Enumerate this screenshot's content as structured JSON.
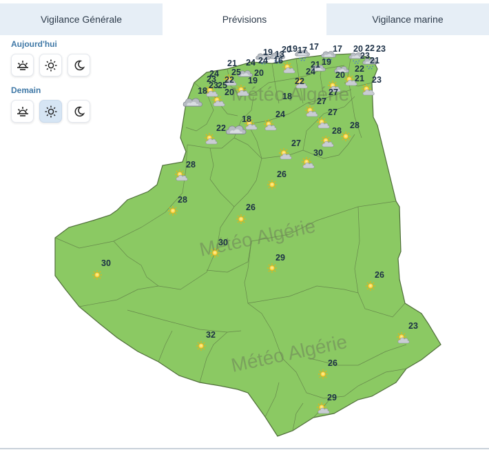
{
  "tabs": [
    {
      "label": "Vigilance Générale",
      "active": false
    },
    {
      "label": "Prévisions",
      "active": true
    },
    {
      "label": "Vigilance marine",
      "active": false
    }
  ],
  "periods": {
    "today_label": "Aujourd'hui",
    "tomorrow_label": "Demain",
    "buttons": [
      "sunrise-icon",
      "sun-icon",
      "moon-icon"
    ],
    "selected": {
      "group": "Demain",
      "button": "sun-icon"
    }
  },
  "watermark": "Météo Algérie",
  "colors": {
    "land": "#8bc963",
    "border": "#5c7a44",
    "tab_inactive": "#e6eef6",
    "label_accent": "#3f78a6"
  },
  "legend_note": "",
  "north_labels": [
    "19",
    "13",
    "20",
    "19",
    "17",
    "17",
    "17",
    "20",
    "22",
    "23",
    "21",
    "24",
    "16",
    "23",
    "21",
    "24",
    "25",
    "20",
    "24",
    "19",
    "23",
    "21",
    "22",
    "22",
    "21",
    "23",
    "24",
    "23",
    "22",
    "19",
    "20",
    "27",
    "18",
    "25",
    "20",
    "18",
    "24",
    "22",
    "27",
    "18",
    "27",
    "28",
    "28",
    "27",
    "30"
  ],
  "south_labels": [
    "26",
    "28",
    "28",
    "26",
    "30",
    "29",
    "30",
    "26",
    "32",
    "23",
    "26",
    "29"
  ]
}
